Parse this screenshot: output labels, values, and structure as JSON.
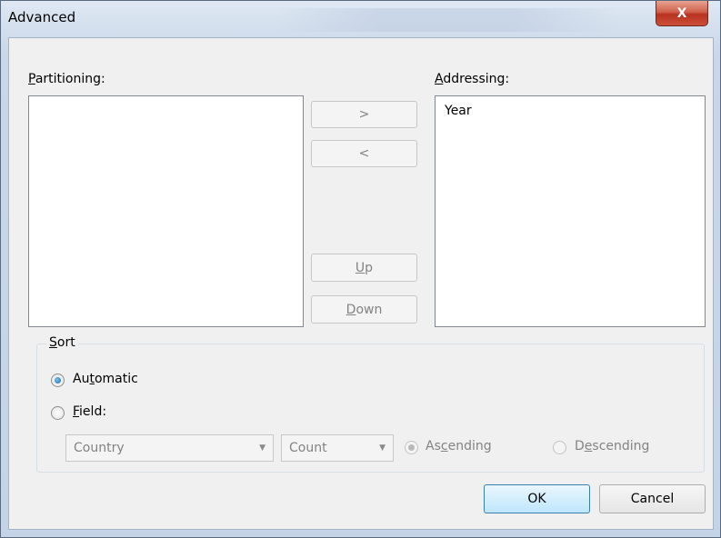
{
  "window": {
    "title": "Advanced",
    "close_glyph": "X"
  },
  "partitioning": {
    "label_prefix": "",
    "label_u": "P",
    "label_rest": "artitioning:",
    "items": []
  },
  "addressing": {
    "label_prefix": "",
    "label_u": "A",
    "label_rest": "ddressing:",
    "items": [
      "Year"
    ]
  },
  "move_buttons": {
    "right": ">",
    "left": "<"
  },
  "order_buttons": {
    "up_u": "U",
    "up_rest": "p",
    "down_u": "D",
    "down_rest": "own"
  },
  "sort": {
    "label_u": "S",
    "label_rest": "ort",
    "automatic": {
      "prefix": "Au",
      "u": "t",
      "rest": "omatic",
      "checked": true
    },
    "field": {
      "prefix": "",
      "u": "F",
      "rest": "ield:",
      "checked": false
    },
    "field_combo": {
      "value": "Country"
    },
    "aggregate_combo": {
      "value": "Count"
    },
    "ascending": {
      "prefix": "As",
      "u": "c",
      "rest": "ending",
      "checked": true
    },
    "descending": {
      "prefix": "D",
      "u": "e",
      "rest": "scending",
      "checked": false
    }
  },
  "footer": {
    "ok": "OK",
    "cancel": "Cancel"
  },
  "icons": {
    "dropdown": "chevron-down-icon",
    "close": "close-icon"
  }
}
